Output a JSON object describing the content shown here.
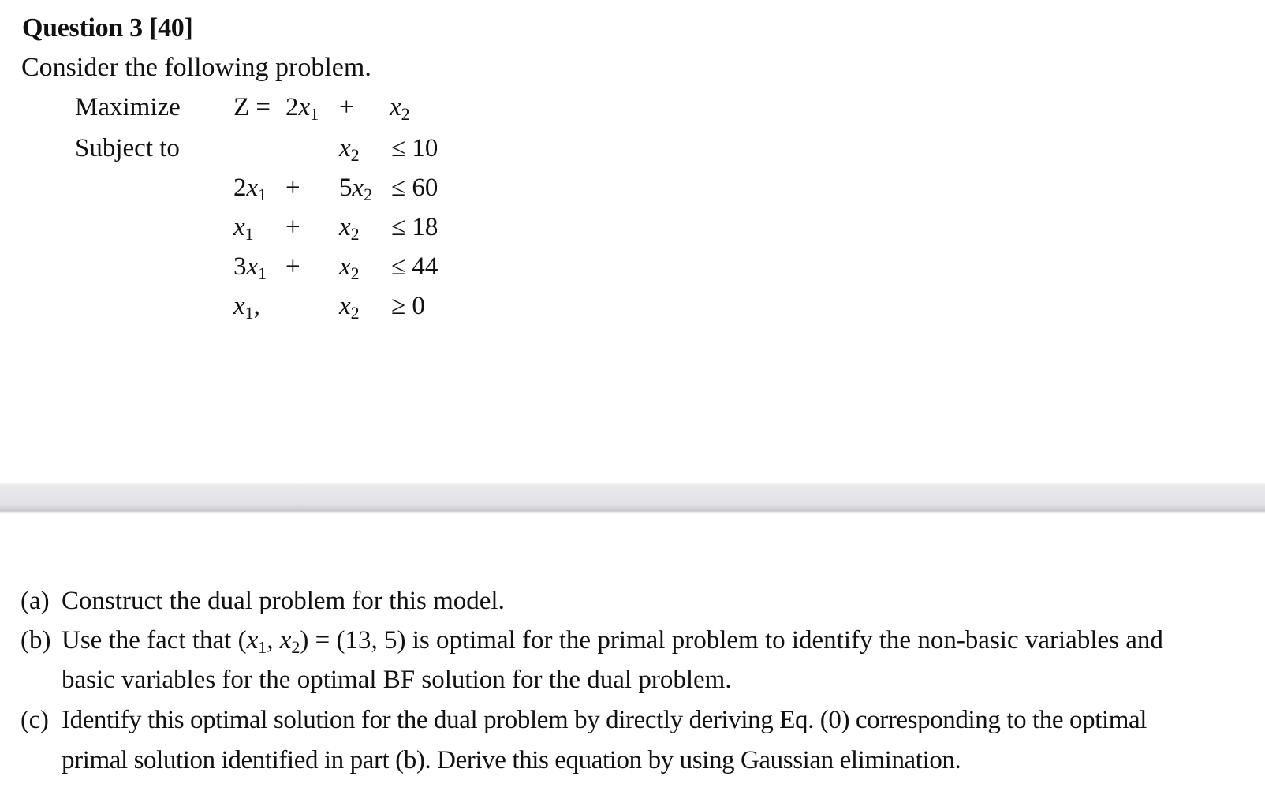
{
  "question": {
    "title": "Question 3 [40]",
    "intro": "Consider the following problem."
  },
  "problem": {
    "objective_label": "Maximize",
    "constraints_label": "Subject to",
    "objective": {
      "lhs": "Z =",
      "term1_coef": "2",
      "term1_var": "x",
      "term1_sub": "1",
      "op": "+",
      "term2_coef": "",
      "term2_var": "x",
      "term2_sub": "2"
    },
    "constraints": [
      {
        "c1": "",
        "v1": "",
        "s1": "",
        "op": "",
        "c2": "",
        "v2": "x",
        "s2": "2",
        "rel": "≤ 10"
      },
      {
        "c1": "2",
        "v1": "x",
        "s1": "1",
        "op": "+",
        "c2": "5",
        "v2": "x",
        "s2": "2",
        "rel": "≤ 60"
      },
      {
        "c1": "",
        "v1": "x",
        "s1": "1",
        "op": "+",
        "c2": "",
        "v2": "x",
        "s2": "2",
        "rel": "≤ 18"
      },
      {
        "c1": "3",
        "v1": "x",
        "s1": "1",
        "op": "+",
        "c2": "",
        "v2": "x",
        "s2": "2",
        "rel": "≤ 44"
      },
      {
        "c1": "",
        "v1": "x",
        "s1": "1",
        "suffix1": ",",
        "op": "",
        "c2": "",
        "v2": "x",
        "s2": "2",
        "rel": "≥ 0"
      }
    ]
  },
  "parts": [
    {
      "marker": "(a)",
      "lines": [
        "Construct the dual problem for this model."
      ]
    },
    {
      "marker": "(b)",
      "lines_prefix": "Use the fact that (",
      "var1": "x",
      "sub1": "1",
      "sep": ", ",
      "var2": "x",
      "sub2": "2",
      "lines_suffix": ") = (13, 5) is optimal for the primal problem to identify the non-basic variables and",
      "line2": "basic variables for the optimal BF solution for the dual problem."
    },
    {
      "marker": "(c)",
      "lines": [
        "Identify this optimal solution for the dual problem by directly deriving Eq. (0) corresponding to the optimal",
        "primal solution identified in part (b). Derive this equation by using Gaussian elimination."
      ]
    }
  ]
}
